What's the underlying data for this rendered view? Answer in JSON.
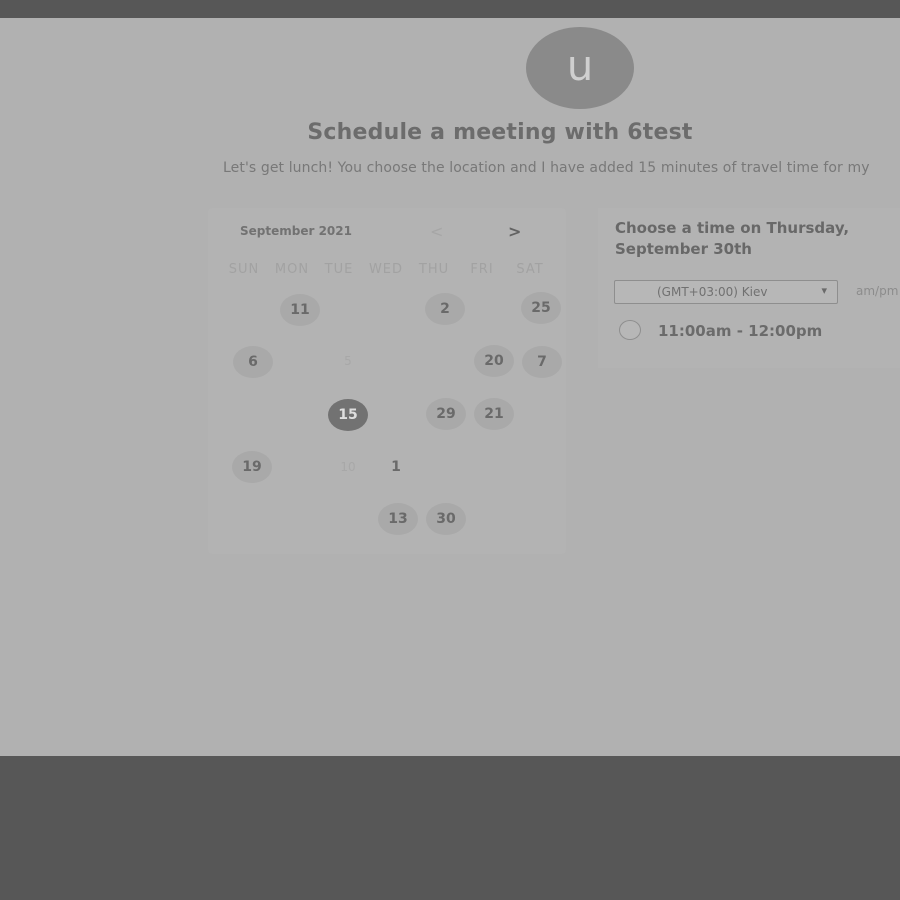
{
  "host": {
    "avatar_letter": "u",
    "title": "Schedule a meeting with 6test",
    "description": "Let's get lunch! You choose the location and I have added 15 minutes of travel time for my"
  },
  "calendar": {
    "month_label": "September 2021",
    "prev_icon": "chevron-left-icon",
    "next_icon": "chevron-right-icon",
    "prev_glyph": "<",
    "next_glyph": ">",
    "weekdays": [
      "SUN",
      "MON",
      "TUE",
      "WED",
      "THU",
      "FRI",
      "SAT"
    ],
    "days": [
      {
        "label": "11",
        "state": "available"
      },
      {
        "label": "2",
        "state": "available"
      },
      {
        "label": "25",
        "state": "available"
      },
      {
        "label": "6",
        "state": "available"
      },
      {
        "label": "5",
        "state": "unavailable"
      },
      {
        "label": "20",
        "state": "available"
      },
      {
        "label": "7",
        "state": "available"
      },
      {
        "label": "15",
        "state": "selected"
      },
      {
        "label": "29",
        "state": "available"
      },
      {
        "label": "21",
        "state": "available"
      },
      {
        "label": "19",
        "state": "available"
      },
      {
        "label": "10",
        "state": "unavailable"
      },
      {
        "label": "1",
        "state": "plain"
      },
      {
        "label": "13",
        "state": "available"
      },
      {
        "label": "30",
        "state": "available"
      }
    ]
  },
  "times": {
    "heading": "Choose a time on Thursday, September 30th",
    "timezone": "(GMT+03:00) Kiev",
    "timezone_caret": "▾",
    "format_label": "am/pm",
    "slots": [
      {
        "label": "11:00am - 12:00pm"
      }
    ]
  },
  "colors": {
    "background": "#b1b1b1",
    "frame": "#575757",
    "selected_day": "#727272",
    "available_day": "#a9a9a9"
  }
}
